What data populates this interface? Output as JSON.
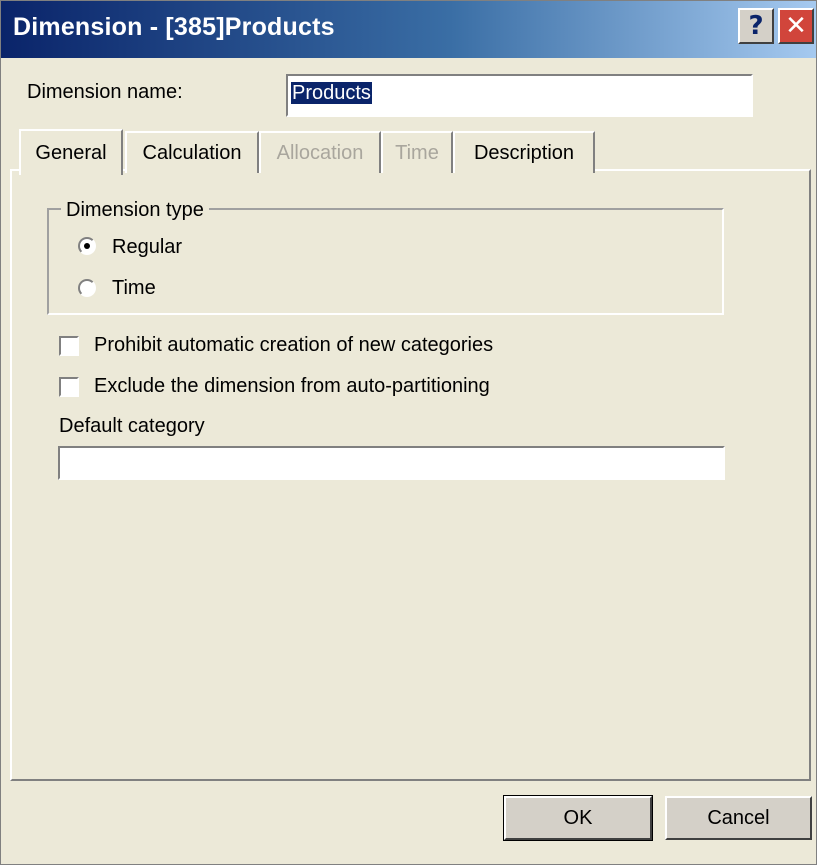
{
  "window": {
    "title": "Dimension - [385]Products",
    "help_button": "?",
    "close_button": "✕"
  },
  "dimension_name": {
    "label": "Dimension name:",
    "value": "Products"
  },
  "tabs": [
    {
      "label": "General",
      "active": true,
      "enabled": true
    },
    {
      "label": "Calculation",
      "active": false,
      "enabled": true
    },
    {
      "label": "Allocation",
      "active": false,
      "enabled": false
    },
    {
      "label": "Time",
      "active": false,
      "enabled": false
    },
    {
      "label": "Description",
      "active": false,
      "enabled": true
    }
  ],
  "general": {
    "dimension_type": {
      "label": "Dimension type",
      "options": [
        {
          "label": "Regular",
          "selected": true
        },
        {
          "label": "Time",
          "selected": false
        }
      ]
    },
    "checkboxes": [
      {
        "label": "Prohibit automatic creation of new categories",
        "checked": false
      },
      {
        "label": "Exclude the dimension from auto-partitioning",
        "checked": false
      }
    ],
    "default_category": {
      "label": "Default category",
      "value": ""
    }
  },
  "buttons": {
    "ok": "OK",
    "cancel": "Cancel"
  },
  "colors": {
    "titlebar_start": "#0a246a",
    "titlebar_end": "#a6caf0",
    "close_button": "#d1453b",
    "dialog_background": "#ece9d8",
    "disabled_text": "#a9a69d"
  }
}
